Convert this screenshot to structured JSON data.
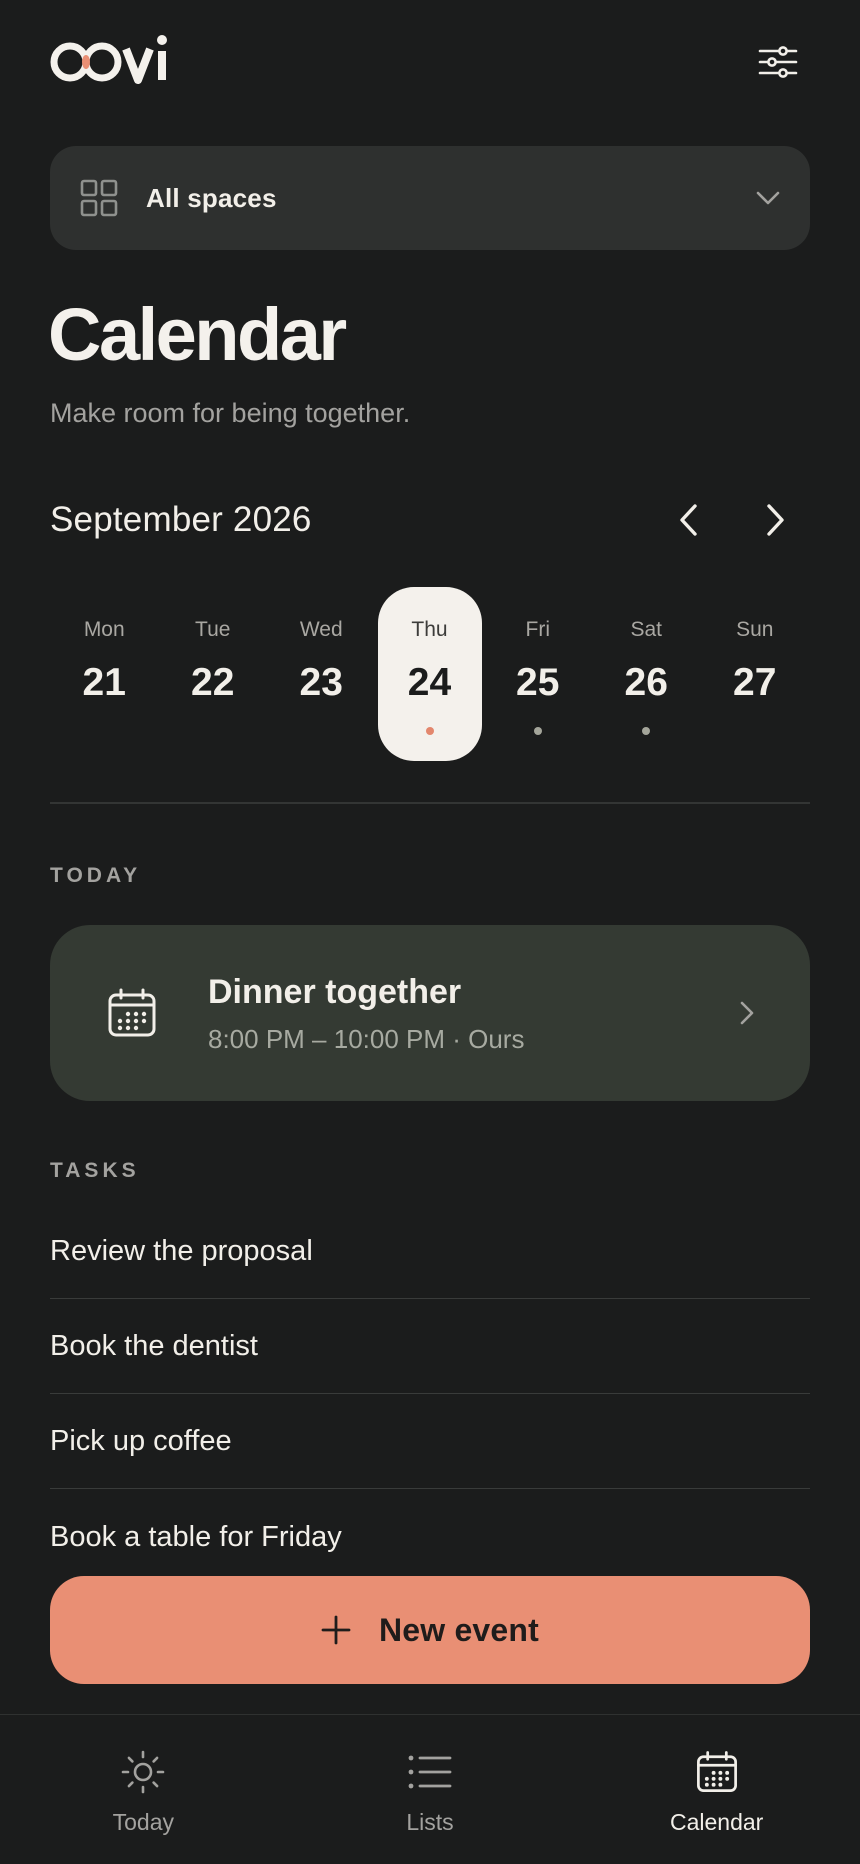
{
  "app": {
    "logo_text": "OOvi"
  },
  "header": {
    "settings_icon": "sliders-icon"
  },
  "spaces": {
    "icon": "grid-icon",
    "label": "All spaces",
    "chevron_icon": "chevron-down-icon"
  },
  "page": {
    "title": "Calendar",
    "subtitle": "Make room for being together."
  },
  "month": {
    "label": "September 2026",
    "prev_icon": "chevron-left-icon",
    "next_icon": "chevron-right-icon"
  },
  "week": {
    "days": [
      {
        "name": "Mon",
        "num": "21",
        "selected": false,
        "has_event": false
      },
      {
        "name": "Tue",
        "num": "22",
        "selected": false,
        "has_event": false
      },
      {
        "name": "Wed",
        "num": "23",
        "selected": false,
        "has_event": false
      },
      {
        "name": "Thu",
        "num": "24",
        "selected": true,
        "has_event": true
      },
      {
        "name": "Fri",
        "num": "25",
        "selected": false,
        "has_event": true
      },
      {
        "name": "Sat",
        "num": "26",
        "selected": false,
        "has_event": true
      },
      {
        "name": "Sun",
        "num": "27",
        "selected": false,
        "has_event": false
      }
    ]
  },
  "today": {
    "section_label": "TODAY",
    "event": {
      "icon": "calendar-icon",
      "title": "Dinner together",
      "meta": "8:00 PM – 10:00 PM · Ours",
      "chevron_icon": "chevron-right-icon"
    }
  },
  "tasks": {
    "section_label": "TASKS",
    "items": [
      {
        "label": "Review the proposal"
      },
      {
        "label": "Book the dentist"
      },
      {
        "label": "Pick up coffee"
      },
      {
        "label": "Book a table for Friday"
      }
    ]
  },
  "new_event": {
    "icon": "plus-icon",
    "label": "New event"
  },
  "bottom_nav": {
    "items": [
      {
        "label": "Today",
        "icon": "sun-icon",
        "active": false
      },
      {
        "label": "Lists",
        "icon": "list-icon",
        "active": false
      },
      {
        "label": "Calendar",
        "icon": "calendar-icon",
        "active": true
      }
    ]
  },
  "colors": {
    "background": "#1b1c1c",
    "card": "#2e302f",
    "event_card": "#343a33",
    "accent": "#e98f74",
    "selected_day": "#f4f1ec",
    "text_primary": "#f2efe9",
    "text_muted": "#a3a29f"
  }
}
